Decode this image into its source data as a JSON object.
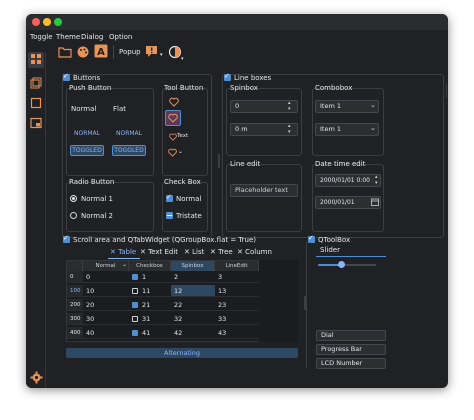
{
  "colors": {
    "accent": "#4f8fd0",
    "toolbar_accent": "#e8935a",
    "window_bg": "#202124"
  },
  "menu": [
    "Toggle",
    "Theme",
    "Dialog",
    "Option"
  ],
  "toolbar": {
    "popup_label": "Popup"
  },
  "buttons_group": {
    "title": "Buttons",
    "push_button": {
      "title": "Push Button",
      "normal": "Normal",
      "flat": "Flat",
      "normal_caps": "NORMAL",
      "toggled_caps": "TOGGLED"
    },
    "tool_button": {
      "title": "Tool Button",
      "text_label": "Text"
    },
    "radio_button": {
      "title": "Radio Button",
      "options": [
        "Normal 1",
        "Normal 2"
      ]
    },
    "check_box": {
      "title": "Check Box",
      "options": [
        "Normal",
        "Tristate"
      ]
    }
  },
  "line_boxes": {
    "title": "Line boxes",
    "spinbox": {
      "title": "Spinbox",
      "values": [
        "0",
        "0 m"
      ]
    },
    "combobox": {
      "title": "Combobox",
      "values": [
        "Item 1",
        "Item 1"
      ]
    },
    "line_edit": {
      "title": "Line edit",
      "placeholder": "Placeholder text"
    },
    "datetime_edit": {
      "title": "Date time edit",
      "values": [
        "2000/01/01 0:00",
        "2000/01/01"
      ]
    }
  },
  "scroll_area": {
    "title": "Scroll area and QTabWidget (QGroupBox.flat = True)",
    "tabs": [
      "Table",
      "Text Edit",
      "List",
      "Tree",
      "Column"
    ],
    "columns": [
      "Normal",
      "Checkbox",
      "Spinbox",
      "LineEdit"
    ],
    "rows": [
      {
        "header": "0",
        "normal": "0",
        "checkbox": "1",
        "spinbox": "2",
        "lineedit": "3",
        "checked": true
      },
      {
        "header": "100",
        "normal": "10",
        "checkbox": "11",
        "spinbox": "12",
        "lineedit": "13",
        "checked": false
      },
      {
        "header": "200",
        "normal": "20",
        "checkbox": "21",
        "spinbox": "22",
        "lineedit": "23",
        "checked": true
      },
      {
        "header": "300",
        "normal": "30",
        "checkbox": "31",
        "spinbox": "32",
        "lineedit": "33",
        "checked": false
      },
      {
        "header": "400",
        "normal": "40",
        "checkbox": "41",
        "spinbox": "42",
        "lineedit": "43",
        "checked": true
      }
    ],
    "alternating_button": "Alternating"
  },
  "qtoolbox": {
    "title": "QToolBox",
    "slider_label": "Slider",
    "slider_value_fraction": 0.4,
    "items": [
      "Dial",
      "Progress Bar",
      "LCD Number"
    ]
  }
}
